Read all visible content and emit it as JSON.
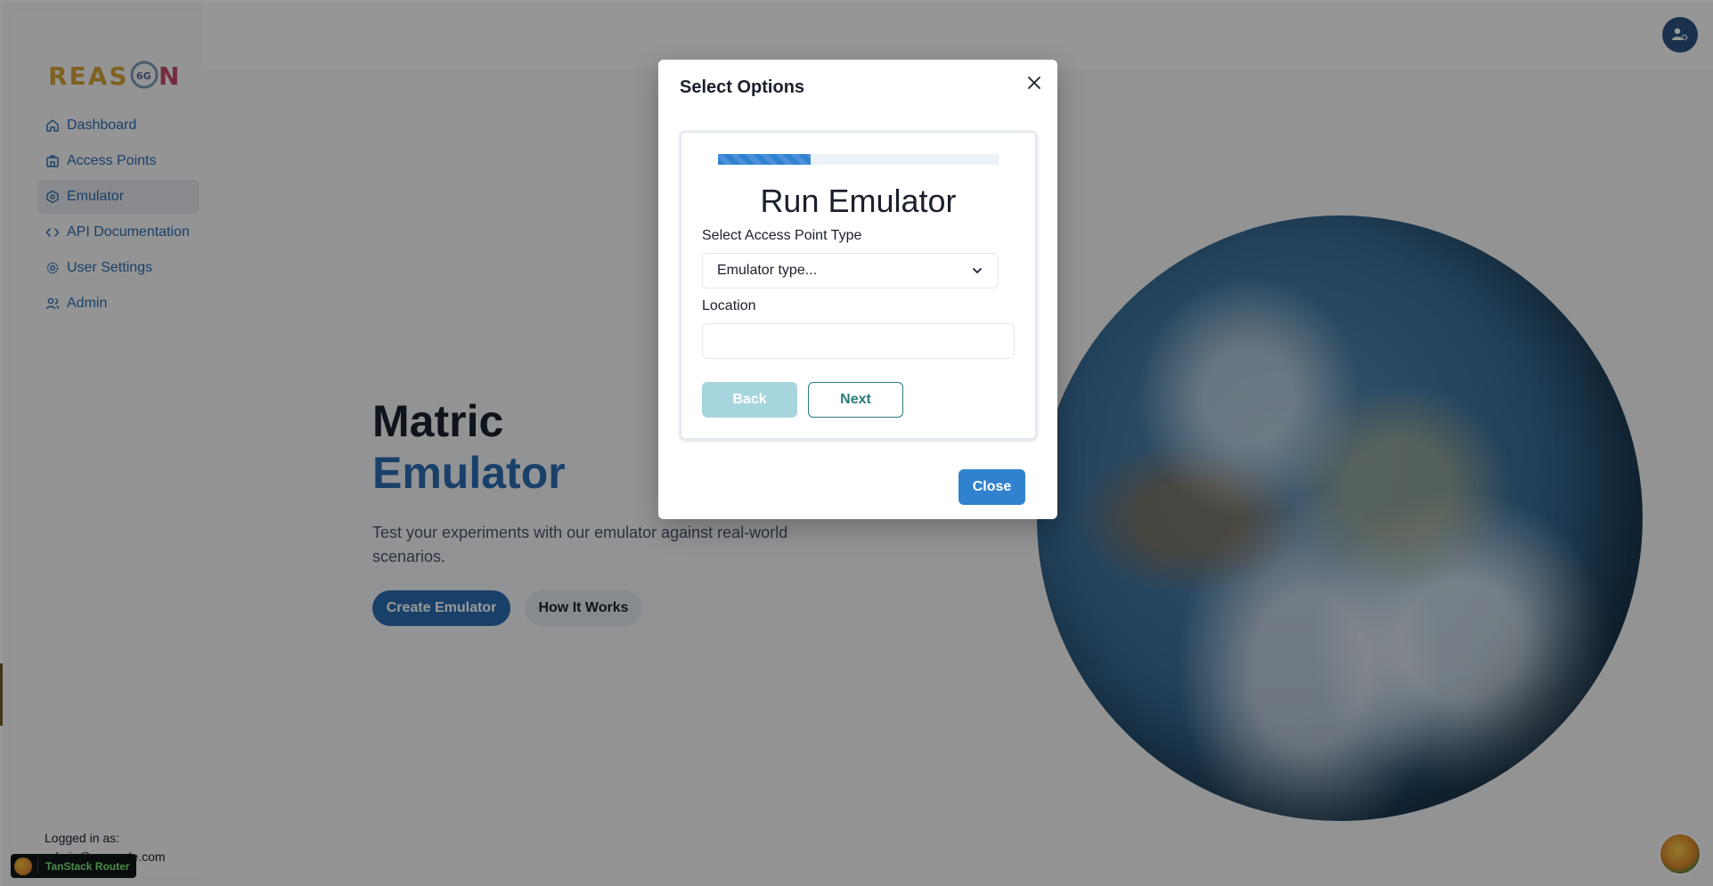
{
  "app": {
    "logo_text": "REASON",
    "logo_badge": "6G"
  },
  "sidebar": {
    "items": [
      {
        "label": "Dashboard",
        "icon": "home-icon"
      },
      {
        "label": "Access Points",
        "icon": "building-icon"
      },
      {
        "label": "Emulator",
        "icon": "emulator-icon",
        "active": true
      },
      {
        "label": "API Documentation",
        "icon": "code-icon"
      },
      {
        "label": "User Settings",
        "icon": "gear-icon"
      },
      {
        "label": "Admin",
        "icon": "users-icon"
      }
    ],
    "logged_in_label": "Logged in as:",
    "logged_in_user": "admin@example.com",
    "devtools_label": "TanStack Router"
  },
  "header": {
    "user_menu_icon": "user-gear-icon"
  },
  "hero": {
    "title_line1": "Matric",
    "title_line2": "Emulator",
    "description": "Test your experiments with our emulator against real-world scenarios.",
    "create_button": "Create Emulator",
    "how_button": "How It Works"
  },
  "modal": {
    "title": "Select Options",
    "progress": 0.33,
    "heading": "Run Emulator",
    "type_label": "Select Access Point Type",
    "type_placeholder": "Emulator type...",
    "location_label": "Location",
    "location_value": "",
    "back_button": "Back",
    "next_button": "Next",
    "close_button": "Close"
  },
  "colors": {
    "brand_blue": "#2b6cb0",
    "primary_button": "#3182ce",
    "teal_outline": "#2c7a7b",
    "disabled_back": "#a7d5de"
  }
}
